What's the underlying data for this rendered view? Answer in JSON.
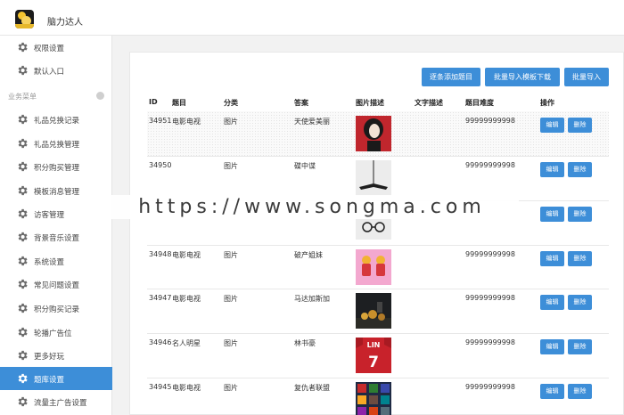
{
  "app": {
    "title": "脑力达人"
  },
  "sidebar": {
    "top_items": [
      {
        "label": "权限设置"
      },
      {
        "label": "默认入口"
      }
    ],
    "section_title": "业务菜单",
    "items": [
      {
        "label": "礼品兑换记录"
      },
      {
        "label": "礼品兑换管理"
      },
      {
        "label": "积分购买管理"
      },
      {
        "label": "模板消息管理"
      },
      {
        "label": "访客管理"
      },
      {
        "label": "背景音乐设置"
      },
      {
        "label": "系统设置"
      },
      {
        "label": "常见问题设置"
      },
      {
        "label": "积分购买记录"
      },
      {
        "label": "轮播广告位"
      },
      {
        "label": "更多好玩"
      },
      {
        "label": "题库设置"
      },
      {
        "label": "流量主广告设置"
      }
    ],
    "active_item": "题库设置"
  },
  "toolbar": {
    "add_label": "逐条添加题目",
    "template_label": "批量导入模板下载",
    "import_label": "批量导入"
  },
  "table": {
    "headers": [
      "ID",
      "题目",
      "分类",
      "答案",
      "图片描述",
      "文字描述",
      "题目难度",
      "操作"
    ],
    "edit_label": "编辑",
    "delete_label": "删除",
    "rows": [
      {
        "id": "34951",
        "title": "电影电视",
        "category": "图片",
        "answer": "天使爱美丽",
        "text_desc": "",
        "difficulty": "99999999998"
      },
      {
        "id": "34950",
        "title": "",
        "category": "图片",
        "answer": "碟中谍",
        "text_desc": "",
        "difficulty": "99999999998"
      },
      {
        "id": "",
        "title": "",
        "category": "",
        "answer": "",
        "text_desc": "",
        "difficulty": ""
      },
      {
        "id": "34948",
        "title": "电影电视",
        "category": "图片",
        "answer": "破产姐妹",
        "text_desc": "",
        "difficulty": "99999999998"
      },
      {
        "id": "34947",
        "title": "电影电视",
        "category": "图片",
        "answer": "马达加斯加",
        "text_desc": "",
        "difficulty": "99999999998"
      },
      {
        "id": "34946",
        "title": "名人明星",
        "category": "图片",
        "answer": "林书豪",
        "text_desc": "",
        "difficulty": "99999999998"
      },
      {
        "id": "34945",
        "title": "电影电视",
        "category": "图片",
        "answer": "复仇者联盟",
        "text_desc": "",
        "difficulty": "99999999998"
      }
    ]
  },
  "thumb_text": {
    "jersey_name": "LIN",
    "jersey_number": "7"
  },
  "watermark": {
    "text": "https://www.songma.com"
  },
  "colors": {
    "accent": "#3d8ed8",
    "sidebar_bg": "#ffffff",
    "page_bg": "#f2f2f2"
  }
}
